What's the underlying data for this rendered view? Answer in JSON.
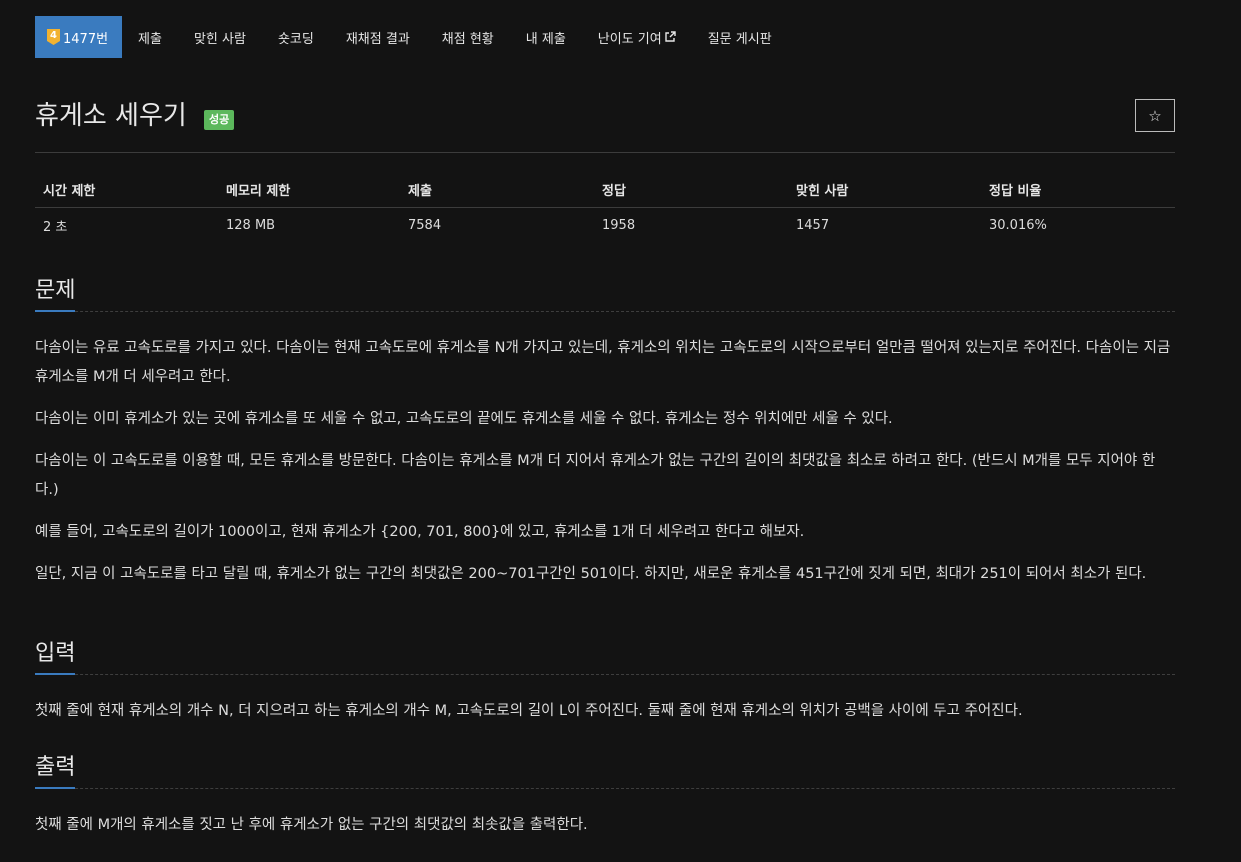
{
  "nav": {
    "tier_badge": "4",
    "problem_number": "1477번",
    "items": [
      "제출",
      "맞힌 사람",
      "숏코딩",
      "재채점 결과",
      "채점 현황",
      "내 제출",
      "난이도 기여",
      "질문 게시판"
    ]
  },
  "problem": {
    "title": "휴게소 세우기",
    "status_badge": "성공",
    "star_icon": "☆"
  },
  "info_table": {
    "headers": [
      "시간 제한",
      "메모리 제한",
      "제출",
      "정답",
      "맞힌 사람",
      "정답 비율"
    ],
    "values": [
      "2 초",
      "128 MB",
      "7584",
      "1958",
      "1457",
      "30.016%"
    ]
  },
  "sections": {
    "description": {
      "heading": "문제",
      "paragraphs": [
        "다솜이는 유료 고속도로를 가지고 있다. 다솜이는 현재 고속도로에 휴게소를 N개 가지고 있는데, 휴게소의 위치는 고속도로의 시작으로부터 얼만큼 떨어져 있는지로 주어진다. 다솜이는 지금 휴게소를 M개 더 세우려고 한다.",
        "다솜이는 이미 휴게소가 있는 곳에 휴게소를 또 세울 수 없고, 고속도로의 끝에도 휴게소를 세울 수 없다. 휴게소는 정수 위치에만 세울 수 있다.",
        "다솜이는 이 고속도로를 이용할 때, 모든 휴게소를 방문한다. 다솜이는 휴게소를 M개 더 지어서 휴게소가 없는 구간의 길이의 최댓값을 최소로 하려고 한다. (반드시 M개를 모두 지어야 한다.)",
        "예를 들어, 고속도로의 길이가 1000이고, 현재 휴게소가 {200, 701, 800}에 있고, 휴게소를 1개 더 세우려고 한다고 해보자.",
        "일단, 지금 이 고속도로를 타고 달릴 때, 휴게소가 없는 구간의 최댓값은 200~701구간인 501이다. 하지만, 새로운 휴게소를 451구간에 짓게 되면, 최대가 251이 되어서 최소가 된다."
      ]
    },
    "input": {
      "heading": "입력",
      "paragraphs": [
        "첫째 줄에 현재 휴게소의 개수 N, 더 지으려고 하는 휴게소의 개수 M, 고속도로의 길이 L이 주어진다. 둘째 줄에 현재 휴게소의 위치가 공백을 사이에 두고 주어진다."
      ]
    },
    "output": {
      "heading": "출력",
      "paragraphs": [
        "첫째 줄에 M개의 휴게소를 짓고 난 후에 휴게소가 없는 구간의 최댓값의 최솟값을 출력한다."
      ]
    }
  }
}
